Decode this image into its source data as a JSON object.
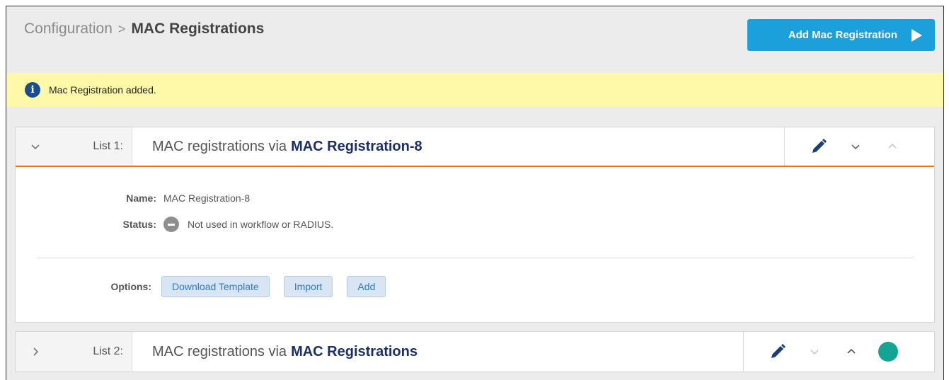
{
  "breadcrumb": {
    "parent": "Configuration",
    "separator": ">",
    "current": "MAC Registrations"
  },
  "header": {
    "add_button_label": "Add Mac Registration",
    "add_button_icon": "play-icon",
    "accent": "#1ca0db"
  },
  "banner": {
    "message": "Mac Registration added.",
    "icon": "info-icon",
    "background": "#fdf9a8"
  },
  "lists": [
    {
      "label": "List 1:",
      "title_prefix": "MAC registrations via",
      "title_name": "MAC Registration-8",
      "expanded": true,
      "toggle_icon": "chevron-down-icon",
      "actions": [
        "pencil-icon",
        "chevron-down-icon",
        "chevron-up-icon"
      ],
      "details": {
        "name_label": "Name:",
        "name_value": "MAC Registration-8",
        "status_label": "Status:",
        "status_value": "Not used in workflow or RADIUS.",
        "status_icon": "minus-circle-icon",
        "options_label": "Options:",
        "options": [
          "Download Template",
          "Import",
          "Add"
        ]
      }
    },
    {
      "label": "List 2:",
      "title_prefix": "MAC registrations via",
      "title_name": "MAC Registrations",
      "expanded": false,
      "toggle_icon": "chevron-right-icon",
      "actions": [
        "pencil-icon",
        "chevron-down-icon",
        "chevron-up-icon",
        "status-dot-icon"
      ],
      "status_color": "#15a394"
    }
  ]
}
